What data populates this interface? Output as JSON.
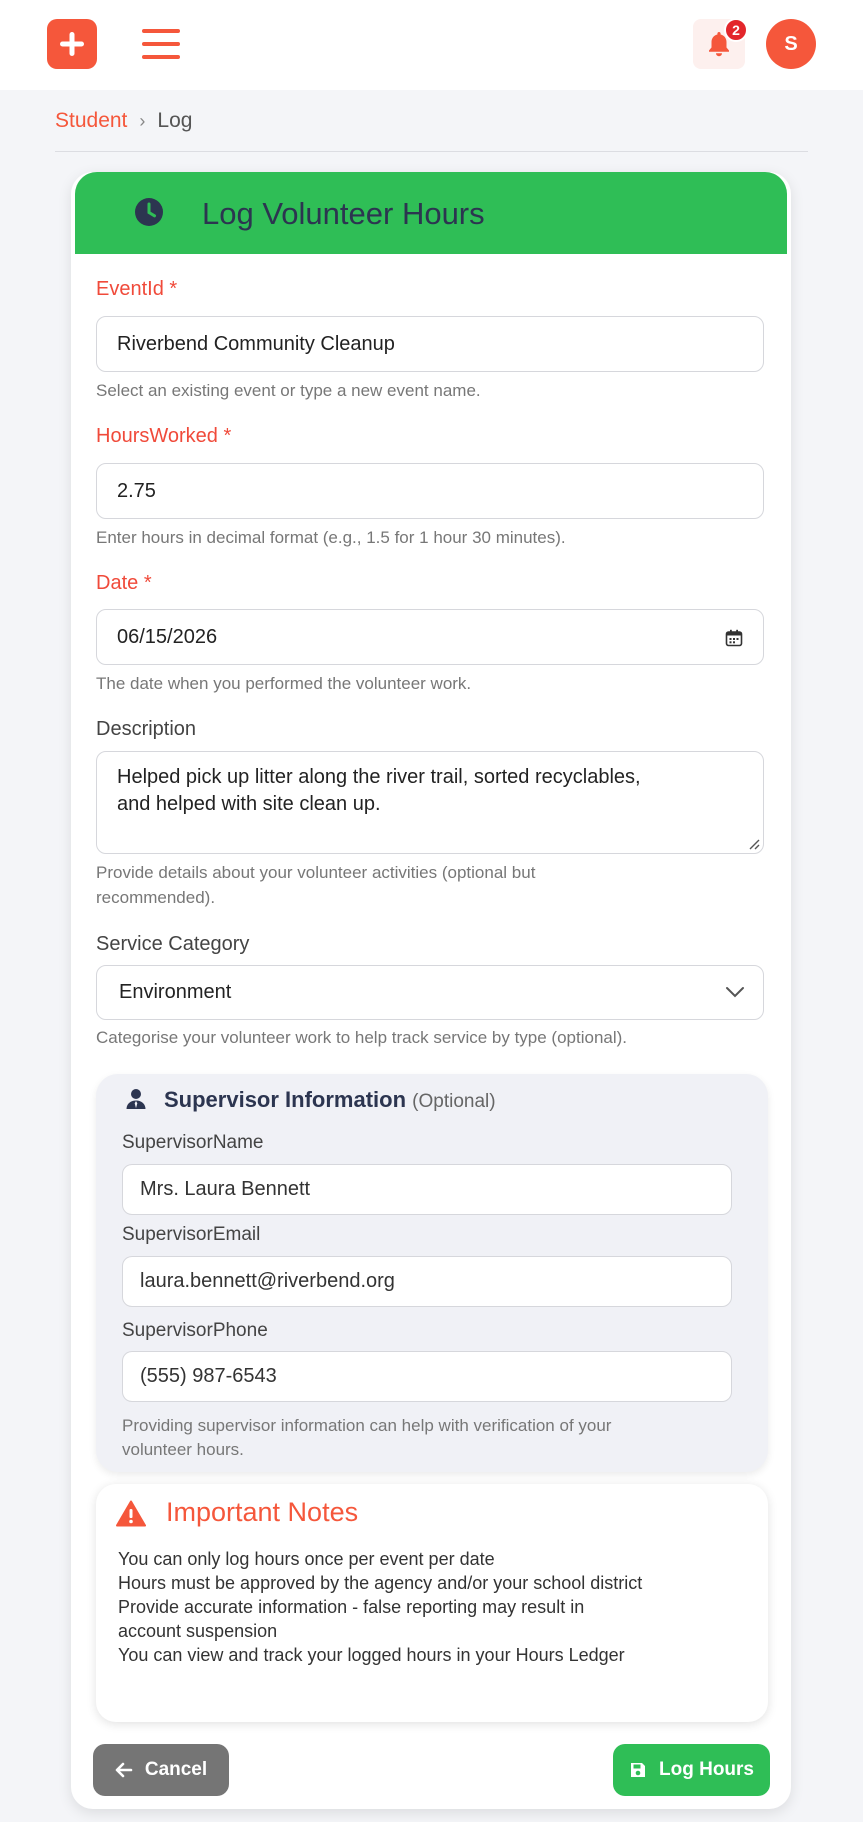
{
  "header": {
    "notification_count": "2",
    "avatar_initial": "S",
    "icons": [
      "plus-icon",
      "hamburger-menu-icon",
      "bell-icon"
    ]
  },
  "breadcrumb": {
    "parent": "Student",
    "separator": "›",
    "current": "Log"
  },
  "form": {
    "title": "Log Volunteer Hours",
    "event": {
      "label": "EventId",
      "required_mark": "*",
      "value": "Riverbend Community Cleanup",
      "help": "Select an existing event or type a new event name."
    },
    "hours": {
      "label": "HoursWorked",
      "required_mark": "*",
      "value": "2.75",
      "help": "Enter hours in decimal format (e.g., 1.5 for 1 hour 30 minutes)."
    },
    "date": {
      "label": "Date",
      "required_mark": "*",
      "value": "06/15/2026",
      "help": "The date when you performed the volunteer work."
    },
    "description": {
      "label": "Description",
      "value": "Helped pick up litter along the river trail, sorted recyclables, and helped with site clean up.",
      "help": "Provide details about your volunteer activities (optional but recommended)."
    },
    "category": {
      "label": "Service Category",
      "value": "Environment",
      "help": "Categorise your volunteer work to help track service by type (optional)."
    },
    "supervisor": {
      "title": "Supervisor Information",
      "optional": "(Optional)",
      "name_label": "SupervisorName",
      "name_value": "Mrs. Laura Bennett",
      "email_label": "SupervisorEmail",
      "email_value": "laura.bennett@riverbend.org",
      "phone_label": "SupervisorPhone",
      "phone_value": "(555) 987-6543",
      "help": "Providing supervisor information can help with verification of your volunteer hours."
    },
    "notes": {
      "title": "Important Notes",
      "items": [
        "You can only log hours once per event per date",
        "Hours must be approved by the agency and/or your school district",
        "Provide accurate information - false reporting may result in account suspension",
        "You can view and track your logged hours in your Hours Ledger"
      ]
    },
    "actions": {
      "cancel_label": "Cancel",
      "submit_label": "Log Hours"
    }
  },
  "colors": {
    "accent": "#f5573b",
    "success": "#2fbe56",
    "required": "#f04a3a",
    "header_text": "#2c3550",
    "cancel": "#757575"
  }
}
